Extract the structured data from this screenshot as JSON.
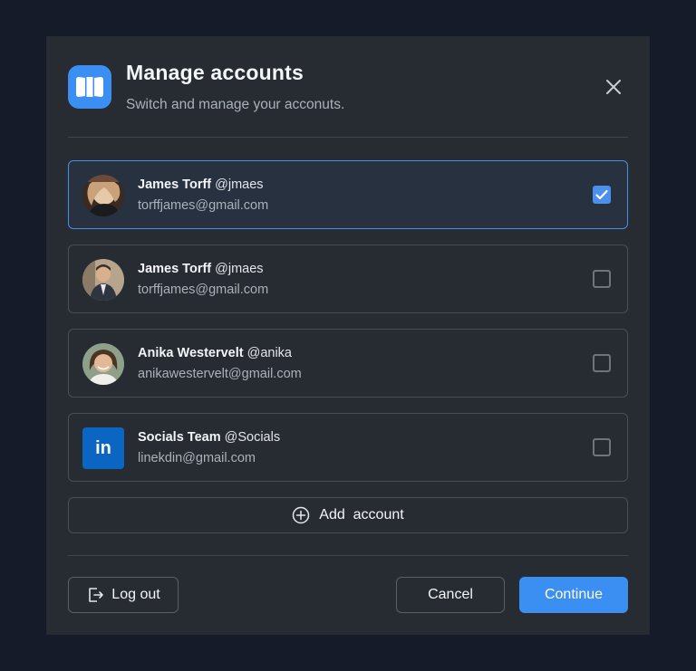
{
  "modal": {
    "title": "Manage accounts",
    "subtitle": "Switch and manage your acconuts."
  },
  "accounts": [
    {
      "name": "James Torff",
      "handle": "@jmaes",
      "email": "torffjames@gmail.com",
      "checked": true
    },
    {
      "name": "James Torff",
      "handle": "@jmaes",
      "email": "torffjames@gmail.com",
      "checked": false
    },
    {
      "name": "Anika Westervelt",
      "handle": "@anika",
      "email": "anikawestervelt@gmail.com",
      "checked": false
    },
    {
      "name": "Socials Team",
      "handle": "@Socials",
      "email": "linekdin@gmail.com",
      "checked": false,
      "avatar_text": "in"
    }
  ],
  "add_account_label": "Add  account",
  "footer": {
    "logout_label": "Log out",
    "cancel_label": "Cancel",
    "continue_label": "Continue"
  },
  "colors": {
    "accent": "#3b8ff2",
    "background": "#151b28",
    "panel": "#272c33",
    "linkedin": "#0a66c2"
  },
  "icons": {
    "logo": "columns-logo-icon",
    "close": "close-icon",
    "checkmark": "checkmark-icon",
    "add": "plus-circle-icon",
    "logout": "logout-icon"
  }
}
